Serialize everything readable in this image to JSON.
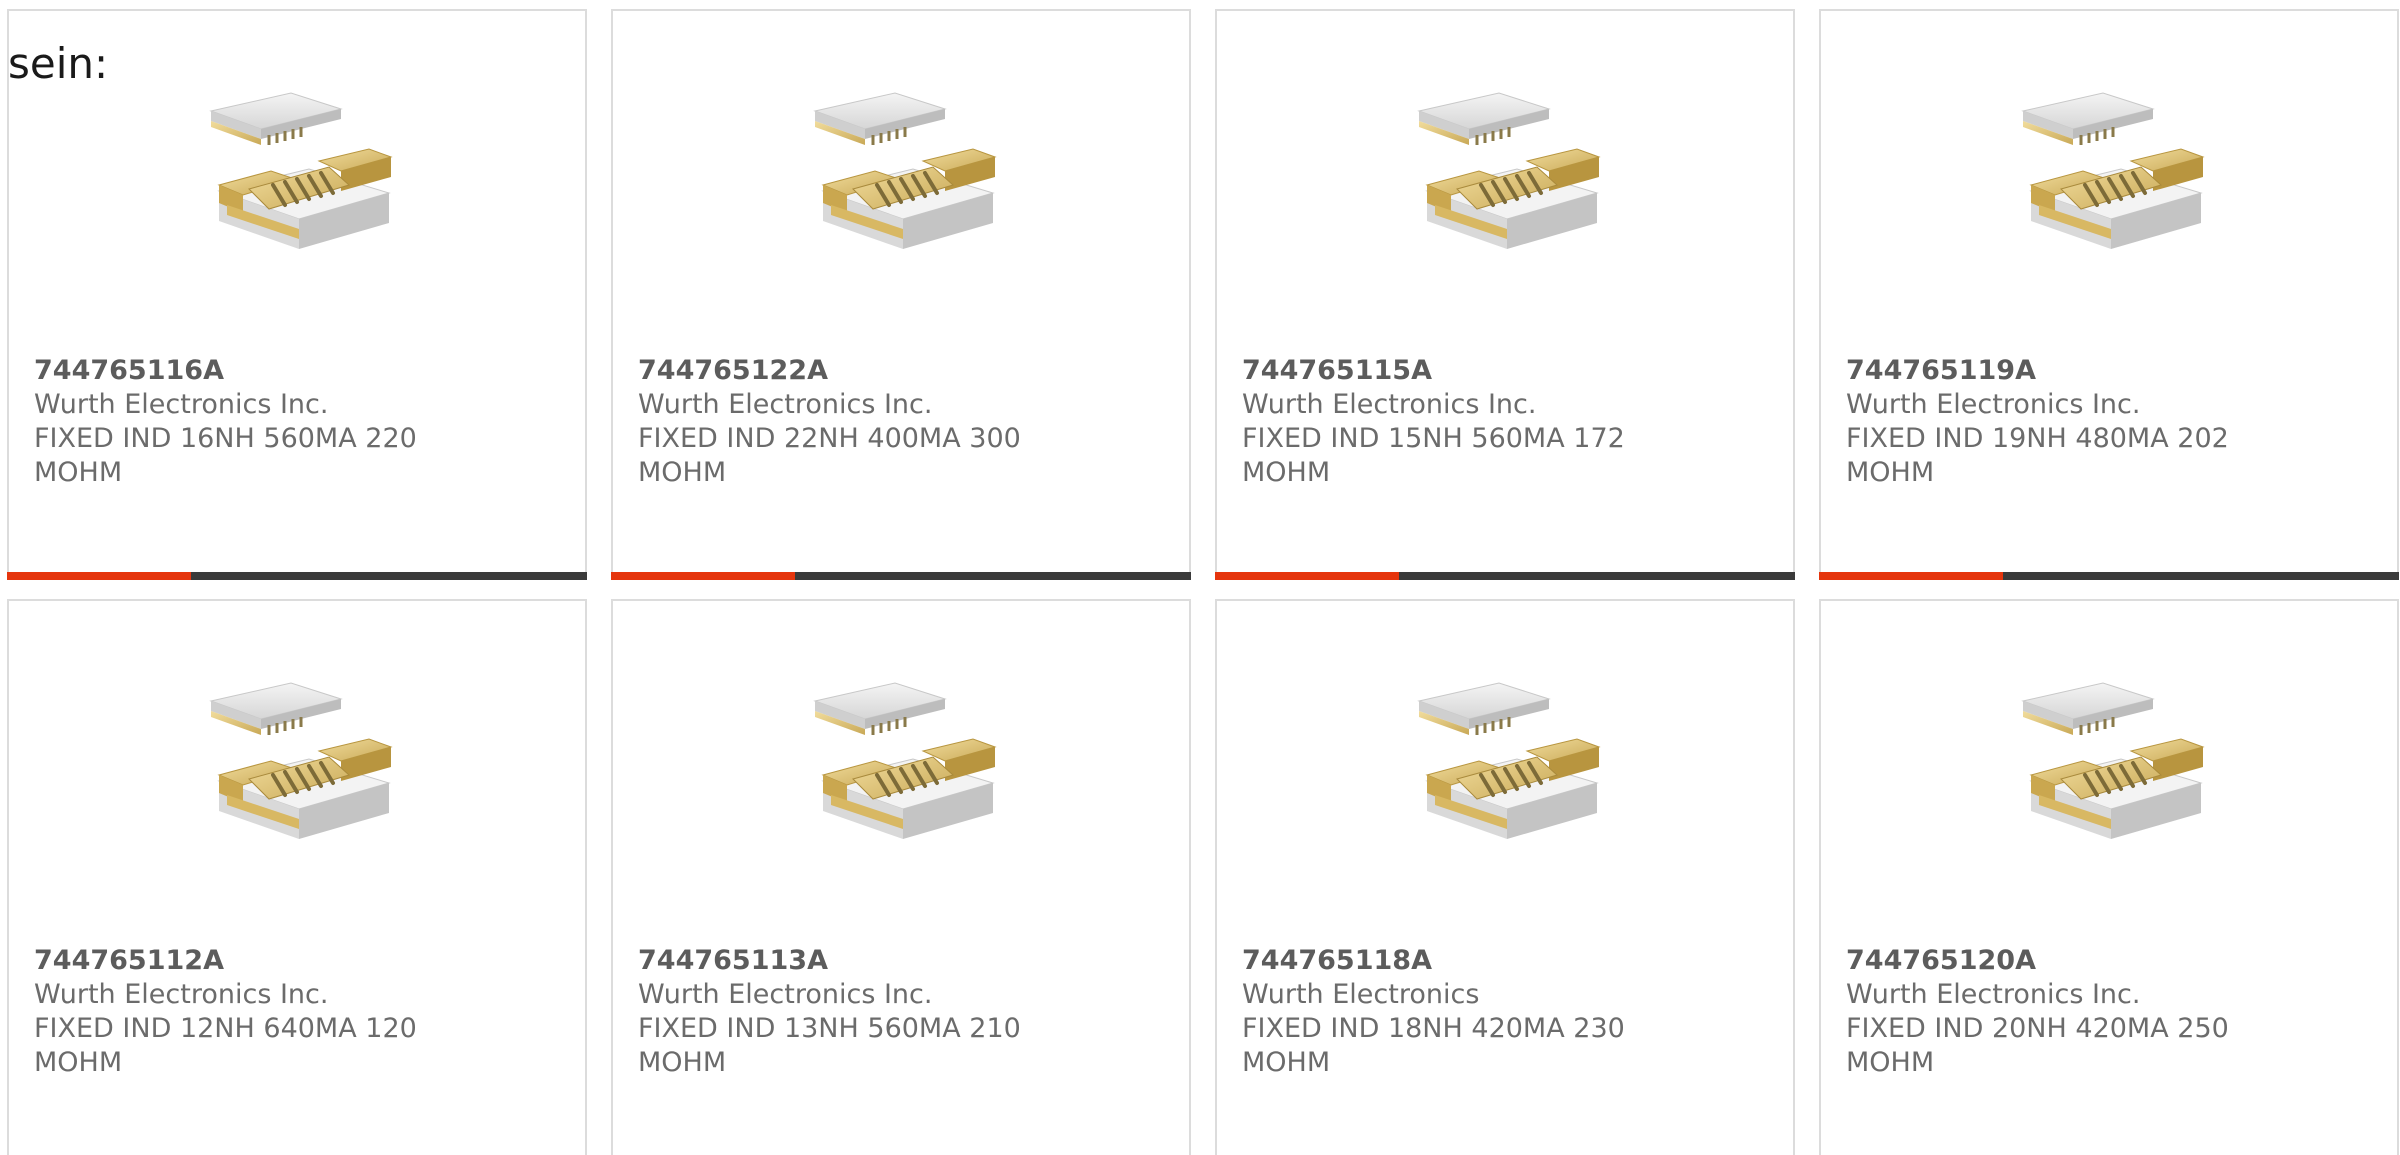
{
  "intro_text": "sein:",
  "colors": {
    "accent": "#e5350d",
    "bar": "#3a3a3a",
    "card_border": "#dcdcdc",
    "text": "#6b6b6b"
  },
  "product_image": "smd-inductor-chip-image",
  "products": [
    {
      "part_number": "744765116A",
      "manufacturer": "Wurth Electronics Inc.",
      "description": "FIXED IND 16NH 560MA 220 MOHM"
    },
    {
      "part_number": "744765122A",
      "manufacturer": "Wurth Electronics Inc.",
      "description": "FIXED IND 22NH 400MA 300 MOHM"
    },
    {
      "part_number": "744765115A",
      "manufacturer": "Wurth Electronics Inc.",
      "description": "FIXED IND 15NH 560MA 172 MOHM"
    },
    {
      "part_number": "744765119A",
      "manufacturer": "Wurth Electronics Inc.",
      "description": "FIXED IND 19NH 480MA 202 MOHM"
    },
    {
      "part_number": "744765112A",
      "manufacturer": "Wurth Electronics Inc.",
      "description": "FIXED IND 12NH 640MA 120 MOHM"
    },
    {
      "part_number": "744765113A",
      "manufacturer": "Wurth Electronics Inc.",
      "description": "FIXED IND 13NH 560MA 210 MOHM"
    },
    {
      "part_number": "744765118A",
      "manufacturer": "Wurth Electronics",
      "description": "FIXED IND 18NH 420MA 230 MOHM"
    },
    {
      "part_number": "744765120A",
      "manufacturer": "Wurth Electronics Inc.",
      "description": "FIXED IND 20NH 420MA 250 MOHM"
    }
  ]
}
